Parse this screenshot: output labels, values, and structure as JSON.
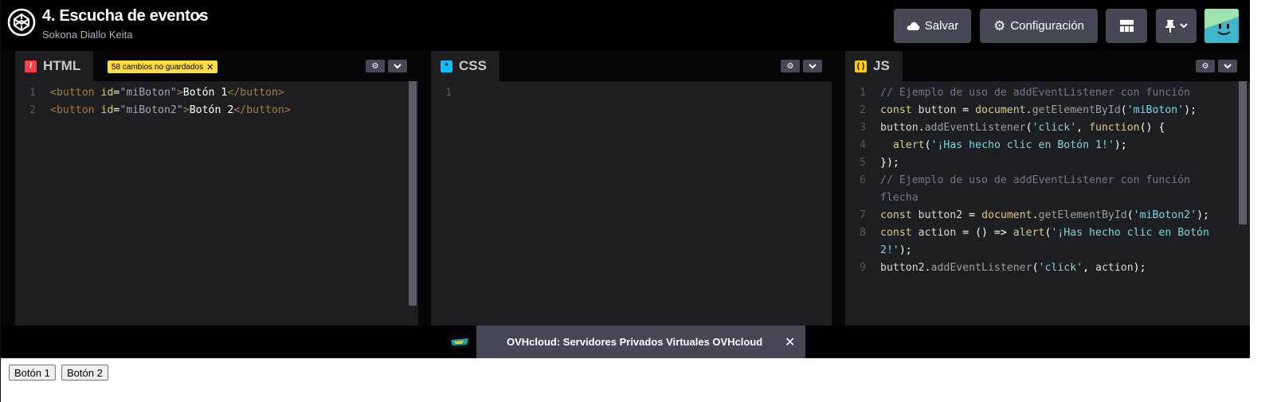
{
  "header": {
    "title": "4. Escucha de eventos",
    "author": "Sokona Diallo Keita",
    "save_label": "Salvar",
    "settings_label": "Configuración"
  },
  "html_panel": {
    "tab": "HTML",
    "unsaved_badge": "58 cambios no guardados",
    "lines": [
      {
        "n": "1",
        "tokens": [
          [
            "c-tag",
            "<button "
          ],
          [
            "c-attr",
            "id"
          ],
          [
            "c-pl",
            "="
          ],
          [
            "c-str",
            "\"miBoton\""
          ],
          [
            "c-tag",
            ">"
          ],
          [
            "c-txt",
            "Botón 1"
          ],
          [
            "c-tag",
            "</button>"
          ]
        ]
      },
      {
        "n": "2",
        "tokens": [
          [
            "c-tag",
            "<button "
          ],
          [
            "c-attr",
            "id"
          ],
          [
            "c-pl",
            "="
          ],
          [
            "c-str",
            "\"miBoton2\""
          ],
          [
            "c-tag",
            ">"
          ],
          [
            "c-txt",
            "Botón 2"
          ],
          [
            "c-tag",
            "</button>"
          ]
        ]
      }
    ]
  },
  "css_panel": {
    "tab": "CSS",
    "lines": [
      {
        "n": "1",
        "tokens": []
      }
    ]
  },
  "js_panel": {
    "tab": "JS",
    "lines": [
      {
        "n": "1",
        "tokens": [
          [
            "c-cm",
            "// Ejemplo de uso de addEventListener con función"
          ]
        ]
      },
      {
        "n": "2",
        "tokens": [
          [
            "c-kw",
            "const "
          ],
          [
            "c-id",
            "button "
          ],
          [
            "c-pl",
            "= "
          ],
          [
            "c-fn",
            "document"
          ],
          [
            "c-pl",
            "."
          ],
          [
            "c-prop",
            "getElementById"
          ],
          [
            "c-pl",
            "("
          ],
          [
            "c-s",
            "'miBoton'"
          ],
          [
            "c-pl",
            ");"
          ]
        ]
      },
      {
        "n": "3",
        "tokens": [
          [
            "c-id",
            "button"
          ],
          [
            "c-pl",
            "."
          ],
          [
            "c-prop",
            "addEventListener"
          ],
          [
            "c-pl",
            "("
          ],
          [
            "c-s",
            "'click'"
          ],
          [
            "c-pl",
            ", "
          ],
          [
            "c-kw",
            "function"
          ],
          [
            "c-pl",
            "() {"
          ]
        ]
      },
      {
        "n": "4",
        "tokens": [
          [
            "c-pl",
            "  "
          ],
          [
            "c-fn",
            "alert"
          ],
          [
            "c-pl",
            "("
          ],
          [
            "c-s",
            "'¡Has hecho clic en Botón 1!'"
          ],
          [
            "c-pl",
            ");"
          ]
        ]
      },
      {
        "n": "5",
        "tokens": [
          [
            "c-pl",
            "});"
          ]
        ]
      },
      {
        "n": "6",
        "tokens": [
          [
            "c-cm",
            "// Ejemplo de uso de addEventListener con función"
          ]
        ]
      },
      {
        "n": "",
        "tokens": [
          [
            "c-cm",
            "flecha"
          ]
        ]
      },
      {
        "n": "7",
        "tokens": [
          [
            "c-kw",
            "const "
          ],
          [
            "c-id",
            "button2 "
          ],
          [
            "c-pl",
            "= "
          ],
          [
            "c-fn",
            "document"
          ],
          [
            "c-pl",
            "."
          ],
          [
            "c-prop",
            "getElementById"
          ],
          [
            "c-pl",
            "("
          ],
          [
            "c-s",
            "'miBoton2'"
          ],
          [
            "c-pl",
            ");"
          ]
        ]
      },
      {
        "n": "8",
        "tokens": [
          [
            "c-kw",
            "const "
          ],
          [
            "c-id",
            "action "
          ],
          [
            "c-pl",
            "= () => "
          ],
          [
            "c-fn",
            "alert"
          ],
          [
            "c-pl",
            "("
          ],
          [
            "c-s",
            "'¡Has hecho clic en Botón"
          ]
        ]
      },
      {
        "n": "",
        "tokens": [
          [
            "c-s",
            "2!'"
          ],
          [
            "c-pl",
            ");"
          ]
        ]
      },
      {
        "n": "9",
        "tokens": [
          [
            "c-id",
            "button2"
          ],
          [
            "c-pl",
            "."
          ],
          [
            "c-prop",
            "addEventListener"
          ],
          [
            "c-pl",
            "("
          ],
          [
            "c-s",
            "'click'"
          ],
          [
            "c-pl",
            ", "
          ],
          [
            "c-id",
            "action"
          ],
          [
            "c-pl",
            ");"
          ]
        ]
      }
    ]
  },
  "ad": {
    "text": "OVHcloud: Servidores Privados Virtuales OVHcloud",
    "close": "✕"
  },
  "preview": {
    "buttons": [
      "Botón 1",
      "Botón 2"
    ]
  }
}
